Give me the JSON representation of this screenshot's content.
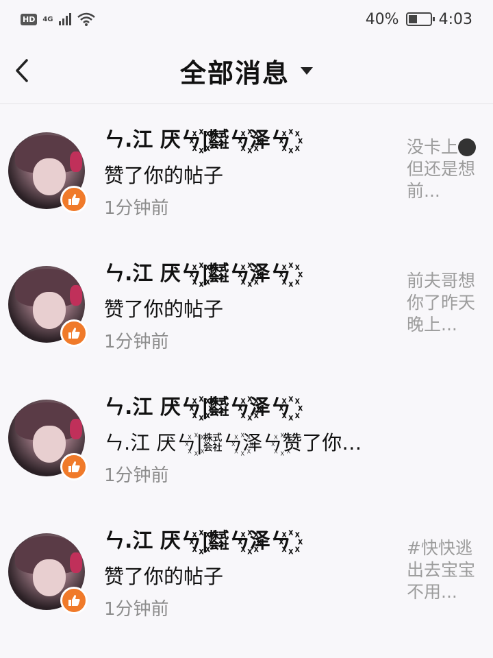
{
  "status_bar": {
    "hd": "HD",
    "network": "4G",
    "battery_percent": "40%",
    "battery_level": 0.4,
    "time": "4:03"
  },
  "header": {
    "title": "全部消息"
  },
  "notifications": [
    {
      "username": "ㄣ.江  厌ㄣ꙰|㍿ㄣ꙰泽ㄣ꙰",
      "action": "赞了你的帖子",
      "time": "1分钟前",
      "preview_before": "没卡上",
      "preview_after": "但还是想前..."
    },
    {
      "username": "ㄣ.江  厌ㄣ꙰|㍿ㄣ꙰泽ㄣ꙰",
      "action": "赞了你的帖子",
      "time": "1分钟前",
      "preview": "前夫哥想你了昨天晚上..."
    },
    {
      "username": "ㄣ.江  厌ㄣ꙰|㍿ㄣ꙰泽ㄣ꙰",
      "action": "ㄣ.江  厌ㄣ꙰|㍿ㄣ꙰泽ㄣ꙰赞了你…",
      "time": "1分钟前",
      "preview": ""
    },
    {
      "username": "ㄣ.江  厌ㄣ꙰|㍿ㄣ꙰泽ㄣ꙰",
      "action": "赞了你的帖子",
      "time": "1分钟前",
      "preview": "#快快逃出去宝宝不用..."
    }
  ],
  "colors": {
    "like_badge": "#f07a2a",
    "muted_text": "#8c8c8c",
    "background": "#f8f7fa"
  }
}
